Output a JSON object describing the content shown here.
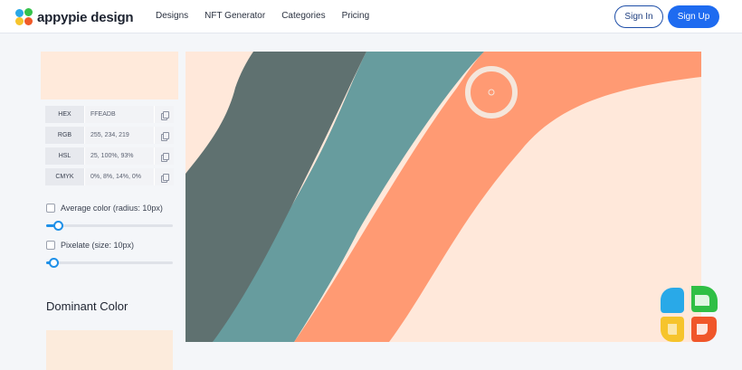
{
  "brand": {
    "name": "appypie design"
  },
  "nav": {
    "links": [
      "Designs",
      "NFT Generator",
      "Categories",
      "Pricing"
    ]
  },
  "auth": {
    "signin": "Sign In",
    "signup": "Sign Up"
  },
  "color": {
    "swatch_hex": "#FFEADB",
    "codes": [
      {
        "label": "HEX",
        "value": "FFEADB"
      },
      {
        "label": "RGB",
        "value": "255, 234, 219"
      },
      {
        "label": "HSL",
        "value": "25, 100%, 93%"
      },
      {
        "label": "CMYK",
        "value": "0%, 8%, 14%, 0%"
      }
    ]
  },
  "options": {
    "average": {
      "label": "Average color (radius: 10px)",
      "checked": false,
      "slider_fraction": 0.09
    },
    "pixelate": {
      "label": "Pixelate (size: 10px)",
      "checked": false,
      "slider_fraction": 0.06
    }
  },
  "dominant": {
    "title": "Dominant Color",
    "swatch_hex": "#FCEBDC"
  },
  "image": {
    "colors": {
      "background": "#FFE8DA",
      "dark": "#5F7170",
      "teal": "#679C9E",
      "salmon": "#FF9A73",
      "picker_ring": "#F5E6DB"
    }
  },
  "icons": {
    "copy": "copy-icon",
    "logo": "appypie-logo-icon",
    "picker": "color-picker-icon"
  }
}
